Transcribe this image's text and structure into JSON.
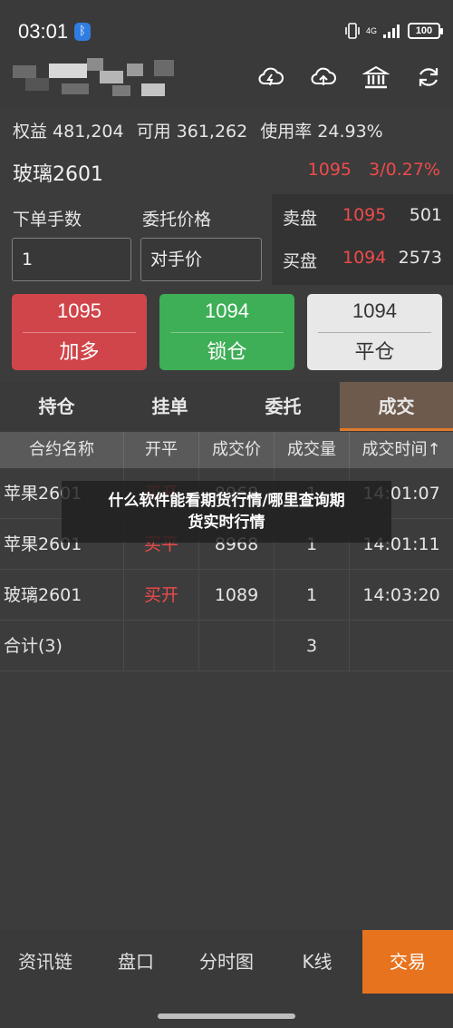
{
  "status_bar": {
    "time": "03:01",
    "network": "4G",
    "battery": "100"
  },
  "header": {
    "icons": [
      "cloud-download-icon",
      "cloud-upload-icon",
      "bank-icon",
      "refresh-icon"
    ]
  },
  "account": {
    "equity": "权益 481,204",
    "available": "可用 361,262",
    "usage": "使用率 24.93%"
  },
  "contract": {
    "name": "玻璃2601",
    "price": "1095",
    "change": "3/0.27%"
  },
  "order_form": {
    "qty_label": "下单手数",
    "price_label": "委托价格",
    "qty_value": "1",
    "price_value": "对手价"
  },
  "quotes": {
    "ask_label": "卖盘",
    "ask_price": "1095",
    "ask_vol": "501",
    "bid_label": "买盘",
    "bid_price": "1094",
    "bid_vol": "2573"
  },
  "actions": {
    "long": {
      "price": "1095",
      "label": "加多"
    },
    "lock": {
      "price": "1094",
      "label": "锁仓"
    },
    "close": {
      "price": "1094",
      "label": "平仓"
    }
  },
  "tabs": [
    "持仓",
    "挂单",
    "委托",
    "成交"
  ],
  "table": {
    "headers": [
      "合约名称",
      "开平",
      "成交价",
      "成交量",
      "成交时间↑"
    ],
    "rows": [
      [
        "苹果2601",
        "买开",
        "8968",
        "1",
        "14:01:07"
      ],
      [
        "苹果2601",
        "买平",
        "8968",
        "1",
        "14:01:11"
      ],
      [
        "玻璃2601",
        "买开",
        "1089",
        "1",
        "14:03:20"
      ]
    ],
    "total_label": "合计(3)",
    "total_qty": "3"
  },
  "overlay": {
    "line1": "什么软件能看期货行情/哪里查询期",
    "line2": "货实时行情"
  },
  "bottom_nav": [
    "资讯链",
    "盘口",
    "分时图",
    "K线",
    "交易"
  ],
  "colors": {
    "background": "#3c3c3c",
    "red": "#ef4a4a",
    "green_button": "#3eae57",
    "accent_orange": "#e8731f"
  }
}
